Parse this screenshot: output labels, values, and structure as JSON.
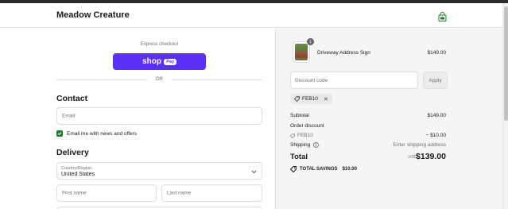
{
  "header": {
    "store_name": "Meadow Creature",
    "cart_icon": "shopping-bag-icon"
  },
  "express": {
    "label": "Express checkout",
    "shop_text": "shop",
    "pay_text": "Pay",
    "or_text": "OR"
  },
  "contact": {
    "title": "Contact",
    "email_placeholder": "Email",
    "newsletter_label": "Email me with news and offers",
    "newsletter_checked": true
  },
  "delivery": {
    "title": "Delivery",
    "country_label": "Country/Region",
    "country_value": "United States",
    "first_name_placeholder": "First name",
    "last_name_placeholder": "Last name"
  },
  "cart": {
    "quantity_badge": "1",
    "product_name": "Driveway Address Sign",
    "product_price": "$149.00",
    "discount_placeholder": "Discount code",
    "apply_label": "Apply",
    "applied_code": "FEB10",
    "remove_symbol": "✕"
  },
  "summary": {
    "subtotal_label": "Subtotal",
    "subtotal_value": "$149.00",
    "order_discount_label": "Order discount",
    "discount_code": "FEB10",
    "discount_value": "− $10.00",
    "shipping_label": "Shipping",
    "shipping_value": "Enter shipping address",
    "total_label": "Total",
    "total_currency": "USD",
    "total_value": "$139.00",
    "savings_label": "TOTAL SAVINGS",
    "savings_value": "$10.00"
  },
  "colors": {
    "shop_pay": "#5a31f4",
    "checkbox": "#1a7d2a",
    "cart_icon": "#1a7d2a"
  }
}
